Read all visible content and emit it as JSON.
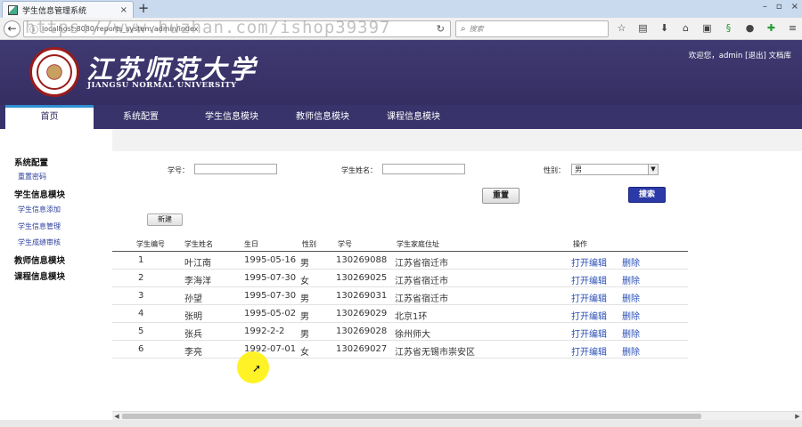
{
  "browser": {
    "tab_title": "学生信息管理系统",
    "tab_close": "×",
    "new_tab": "+",
    "window_controls": [
      "–",
      "▫",
      "×"
    ],
    "url": "localhost:8080/reports_system/admin/index",
    "watermark": "https://www.huzhan.com/ishop39397",
    "search_placeholder": "搜索",
    "toolbar_icons": [
      "star-icon",
      "clipboard-icon",
      "download-icon",
      "home-icon",
      "screenshot-icon",
      "green-s-icon",
      "chat-icon",
      "extension-icon",
      "menu-icon"
    ]
  },
  "header": {
    "uni_name_cn": "江苏师范大学",
    "uni_name_en": "JIANGSU NORMAL UNIVERSITY",
    "welcome": "欢迎您，admin",
    "logout": "[退出]",
    "docs": "文档库"
  },
  "mainnav": [
    {
      "label": "首页",
      "active": true
    },
    {
      "label": "系统配置",
      "active": false
    },
    {
      "label": "学生信息模块",
      "active": false
    },
    {
      "label": "教师信息模块",
      "active": false
    },
    {
      "label": "课程信息模块",
      "active": false
    }
  ],
  "sidebar": {
    "group1": "系统配置",
    "link1": "重置密码",
    "group2": "学生信息模块",
    "link2": "学生信息添加",
    "link3": "学生信息管理",
    "link4": "学生成绩审核",
    "group3": "教师信息模块",
    "group4": "课程信息模块"
  },
  "form": {
    "student_id_label": "学号：",
    "student_id_value": "",
    "student_name_label": "学生姓名：",
    "student_name_value": "",
    "gender_label": "性别：",
    "gender_value": "男",
    "reset_button": "重置",
    "search_button": "搜索",
    "new_button": "新建"
  },
  "table": {
    "headers": [
      "学生编号",
      "学生姓名",
      "生日",
      "性别",
      "学号",
      "学生家庭住址",
      "操作"
    ],
    "rows": [
      [
        "1",
        "叶江南",
        "1995-05-16",
        "男",
        "130269088",
        "江苏省宿迁市",
        "打开编辑",
        "删除"
      ],
      [
        "2",
        "李海洋",
        "1995-07-30",
        "女",
        "130269025",
        "江苏省宿迁市",
        "打开编辑",
        "删除"
      ],
      [
        "3",
        "孙望",
        "1995-07-30",
        "男",
        "130269031",
        "江苏省宿迁市",
        "打开编辑",
        "删除"
      ],
      [
        "4",
        "张明",
        "1995-05-02",
        "男",
        "130269029",
        "北京1环",
        "打开编辑",
        "删除"
      ],
      [
        "5",
        "张兵",
        "1992-2-2",
        "男",
        "130269028",
        "徐州师大",
        "打开编辑",
        "删除"
      ],
      [
        "6",
        "李亮",
        "1992-07-01",
        "女",
        "130269027",
        "江苏省无锡市崇安区",
        "打开编辑",
        "删除"
      ]
    ]
  },
  "colors": {
    "header_bg": "#3a346c",
    "nav_active_border": "#2e8fd0",
    "link": "#2b50b8",
    "search_button_bg": "#2b3aa6"
  }
}
